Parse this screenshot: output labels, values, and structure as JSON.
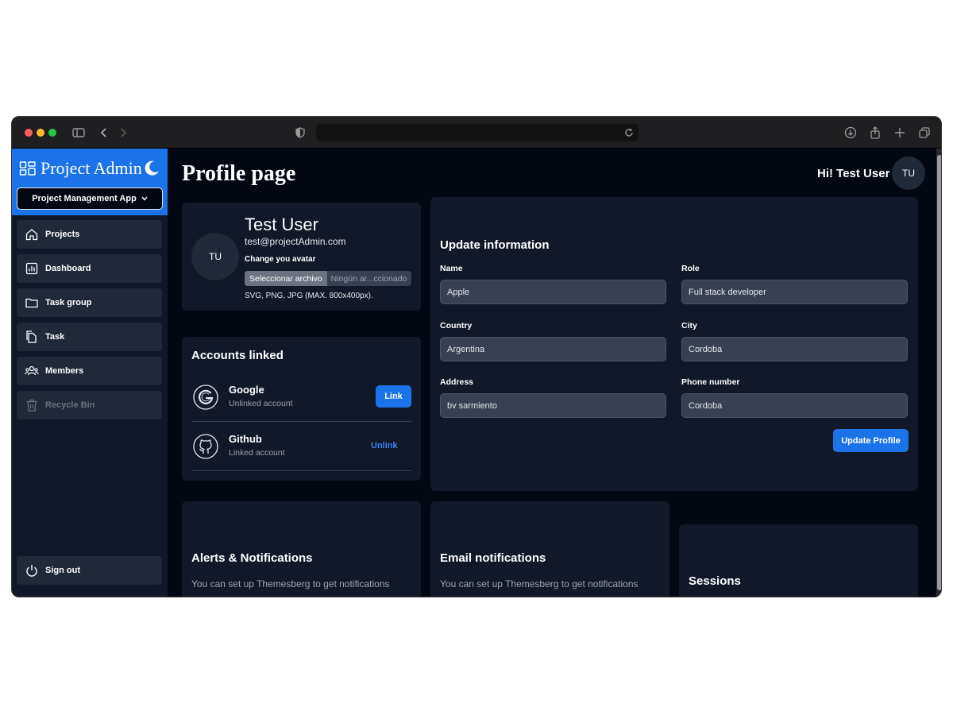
{
  "sidebar": {
    "brand": "Project Admin",
    "app_select": "Project Management App",
    "items": [
      {
        "label": "Projects"
      },
      {
        "label": "Dashboard"
      },
      {
        "label": "Task group"
      },
      {
        "label": "Task"
      },
      {
        "label": "Members"
      },
      {
        "label": "Recycle Bin"
      }
    ],
    "sign_out": "Sign out"
  },
  "header": {
    "title": "Profile page",
    "greeting": "Hi! Test User",
    "avatar_initials": "TU"
  },
  "profile": {
    "initials": "TU",
    "name": "Test User",
    "email": "test@projectAdmin.com",
    "avatar_label": "Change you avatar",
    "file_button": "Seleccionar archivo",
    "file_status": "Ningún ar...ccionado",
    "file_hint": "SVG, PNG, JPG (MAX. 800x400px)."
  },
  "accounts": {
    "heading": "Accounts linked",
    "items": [
      {
        "name": "Google",
        "status": "Unlinked account",
        "action": "Link"
      },
      {
        "name": "Github",
        "status": "Linked account",
        "action": "Unlink"
      }
    ]
  },
  "update_info": {
    "heading": "Update information",
    "fields": {
      "name": {
        "label": "Name",
        "value": "Apple"
      },
      "role": {
        "label": "Role",
        "value": "Full stack developer"
      },
      "country": {
        "label": "Country",
        "value": "Argentina"
      },
      "city": {
        "label": "City",
        "value": "Cordoba"
      },
      "address": {
        "label": "Address",
        "value": "bv sarmiento"
      },
      "phone": {
        "label": "Phone number",
        "value": "Cordoba"
      }
    },
    "submit": "Update Profile"
  },
  "alerts": {
    "heading": "Alerts & Notifications",
    "text": "You can set up Themesberg to get notifications"
  },
  "email_notifications": {
    "heading": "Email notifications",
    "text": "You can set up Themesberg to get notifications"
  },
  "sessions": {
    "heading": "Sessions"
  },
  "colors": {
    "accent": "#1a73e8",
    "background": "#030712",
    "card": "#111827",
    "input": "#374151"
  }
}
